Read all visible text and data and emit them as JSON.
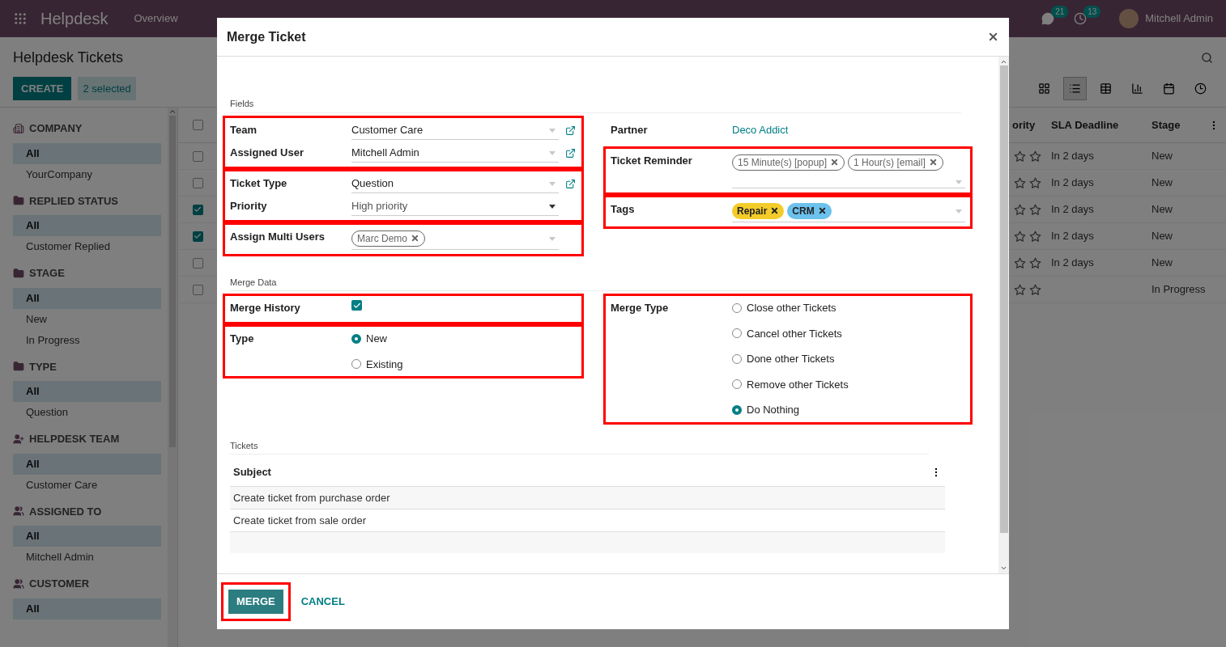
{
  "navbar": {
    "app": "Helpdesk",
    "menu": [
      "Overview"
    ],
    "messages_badge": "21",
    "activities_badge": "13",
    "user": "Mitchell Admin"
  },
  "control_panel": {
    "title": "Helpdesk Tickets",
    "create": "CREATE",
    "selection": "2 selected"
  },
  "sidebar": [
    {
      "title": "COMPANY",
      "items": [
        {
          "label": "All",
          "selected": true
        },
        {
          "label": "YourCompany",
          "selected": false
        }
      ]
    },
    {
      "title": "REPLIED STATUS",
      "items": [
        {
          "label": "All",
          "selected": true
        },
        {
          "label": "Customer Replied",
          "selected": false
        }
      ]
    },
    {
      "title": "STAGE",
      "items": [
        {
          "label": "All",
          "selected": true
        },
        {
          "label": "New",
          "selected": false
        },
        {
          "label": "In Progress",
          "selected": false
        }
      ]
    },
    {
      "title": "TYPE",
      "items": [
        {
          "label": "All",
          "selected": true
        },
        {
          "label": "Question",
          "selected": false
        }
      ]
    },
    {
      "title": "HELPDESK TEAM",
      "items": [
        {
          "label": "All",
          "selected": true
        },
        {
          "label": "Customer Care",
          "selected": false
        }
      ]
    },
    {
      "title": "ASSIGNED TO",
      "items": [
        {
          "label": "All",
          "selected": true
        },
        {
          "label": "Mitchell Admin",
          "selected": false
        }
      ]
    },
    {
      "title": "CUSTOMER",
      "items": [
        {
          "label": "All",
          "selected": true
        }
      ]
    }
  ],
  "list": {
    "header_checked": false,
    "columns": [
      "ority",
      "SLA Deadline",
      "Stage"
    ],
    "rows": [
      {
        "checked": false,
        "sla": "In 2 days",
        "stage": "New"
      },
      {
        "checked": false,
        "sla": "In 2 days",
        "stage": "New"
      },
      {
        "checked": true,
        "sla": "In 2 days",
        "stage": "New"
      },
      {
        "checked": true,
        "sla": "In 2 days",
        "stage": "New"
      },
      {
        "checked": false,
        "sla": "In 2 days",
        "stage": "New"
      },
      {
        "checked": false,
        "stage": "In Progress"
      }
    ]
  },
  "dialog": {
    "title": "Merge Ticket",
    "fields_section": {
      "title": "Fields",
      "left": [
        {
          "highlighted": true,
          "fields": [
            {
              "kind": "select",
              "label": "Team",
              "value": "Customer Care",
              "link": true
            },
            {
              "kind": "select",
              "label": "Assigned User",
              "value": "Mitchell Admin",
              "link": true
            }
          ]
        },
        {
          "highlighted": true,
          "fields": [
            {
              "kind": "select",
              "label": "Ticket Type",
              "value": "Question",
              "link": true
            },
            {
              "kind": "select",
              "label": "Priority",
              "value": "High priority",
              "link": false
            }
          ]
        },
        {
          "highlighted": true,
          "fields": [
            {
              "kind": "tags",
              "label": "Assign Multi Users",
              "tags": [
                {
                  "label": "Marc Demo"
                }
              ]
            }
          ]
        }
      ],
      "right": [
        {
          "highlighted": false,
          "fields": [
            {
              "kind": "link",
              "label": "Partner",
              "value": "Deco Addict"
            }
          ]
        },
        {
          "highlighted": true,
          "fields": [
            {
              "kind": "tags",
              "label": "Ticket Reminder",
              "tags": [
                {
                  "label": "15 Minute(s) [popup]"
                },
                {
                  "label": "1 Hour(s) [email]"
                }
              ]
            }
          ]
        },
        {
          "highlighted": true,
          "fields": [
            {
              "kind": "tags",
              "label": "Tags",
              "tags": [
                {
                  "label": "Repair",
                  "color": "#f4cc2a"
                },
                {
                  "label": "CRM",
                  "color": "#6cc1ed"
                }
              ]
            }
          ]
        }
      ]
    },
    "merge_section": {
      "title": "Merge Data",
      "left": [
        {
          "highlighted": true,
          "fields": [
            {
              "kind": "checkbox",
              "label": "Merge History",
              "checked": true
            }
          ]
        },
        {
          "highlighted": true,
          "fields": [
            {
              "kind": "radio",
              "label": "Type",
              "options": [
                {
                  "label": "New",
                  "selected": true
                },
                {
                  "label": "Existing",
                  "selected": false
                }
              ]
            }
          ]
        }
      ],
      "right": [
        {
          "highlighted": true,
          "fields": [
            {
              "kind": "radio",
              "label": "Merge Type",
              "options": [
                {
                  "label": "Close other Tickets",
                  "selected": false
                },
                {
                  "label": "Cancel other Tickets",
                  "selected": false
                },
                {
                  "label": "Done other Tickets",
                  "selected": false
                },
                {
                  "label": "Remove other Tickets",
                  "selected": false
                },
                {
                  "label": "Do Nothing",
                  "selected": true
                }
              ]
            }
          ]
        }
      ]
    },
    "tickets": {
      "title": "Tickets",
      "column": "Subject",
      "rows": [
        "Create ticket from purchase order",
        "Create ticket from sale order"
      ]
    },
    "buttons": [
      {
        "kind": "primary",
        "label": "MERGE",
        "highlighted": true
      },
      {
        "kind": "link",
        "label": "CANCEL",
        "highlighted": false
      }
    ]
  }
}
